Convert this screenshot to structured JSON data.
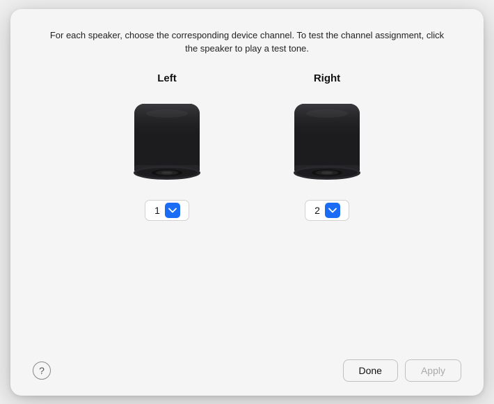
{
  "dialog": {
    "instruction": "For each speaker, choose the corresponding device channel. To test the channel assignment, click the speaker to play a test tone.",
    "speakers": [
      {
        "id": "left",
        "label": "Left",
        "channel_value": "1"
      },
      {
        "id": "right",
        "label": "Right",
        "channel_value": "2"
      }
    ],
    "footer": {
      "help_label": "?",
      "done_label": "Done",
      "apply_label": "Apply"
    }
  }
}
